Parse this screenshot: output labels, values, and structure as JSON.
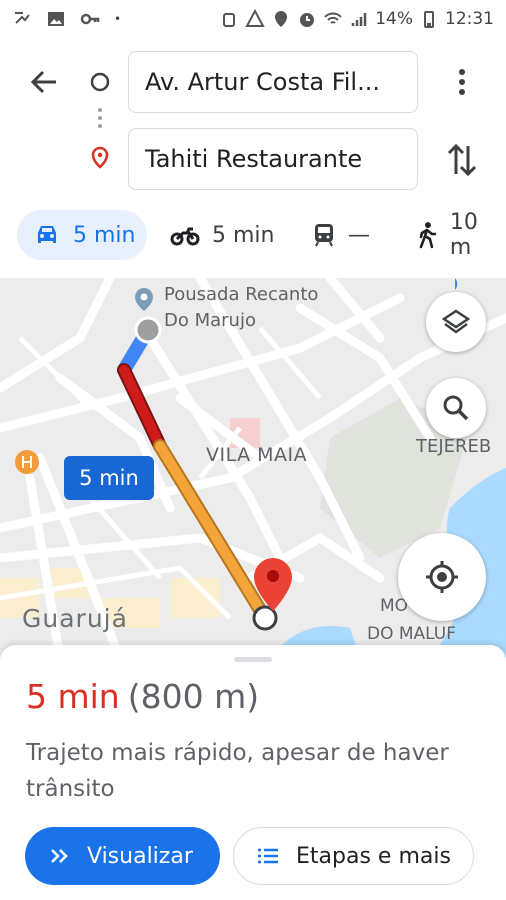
{
  "status_bar": {
    "battery": "14%",
    "time": "12:31"
  },
  "directions": {
    "origin": "Av. Artur Costa Fil...",
    "destination": "Tahiti Restaurante"
  },
  "modes": [
    {
      "name": "car",
      "label": "5 min",
      "selected": true
    },
    {
      "name": "motorcycle",
      "label": "5 min",
      "selected": false
    },
    {
      "name": "transit",
      "label": "—",
      "selected": false
    },
    {
      "name": "walk",
      "label": "10 m",
      "selected": false
    }
  ],
  "map": {
    "labels": {
      "pousada": "Pousada Recanto\nDo Marujo",
      "vila_maia": "VILA MAIA",
      "tejereba": "TEJEREB",
      "guaruja": "Guarujá",
      "moro": "MO",
      "maluf": "DO MALUF"
    },
    "route_badge": "5 min",
    "route_color_heavy": "#d01b1b",
    "route_color_medium": "#f3a53a",
    "route_color_clear": "#4285f4"
  },
  "sheet": {
    "time": "5 min",
    "distance": "(800 m)",
    "description": "Trajeto mais rápido, apesar de haver trânsito",
    "preview_button": "Visualizar",
    "steps_button": "Etapas e mais"
  }
}
